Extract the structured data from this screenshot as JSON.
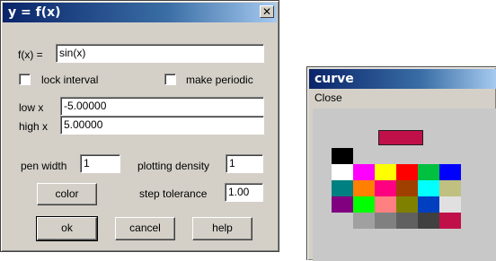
{
  "dialog": {
    "title": "y = f(x)",
    "close_glyph": "✕",
    "fx_label": "f(x) =",
    "fx_value": "sin(x)",
    "lock_interval_label": "lock interval",
    "make_periodic_label": "make periodic",
    "low_x_label": "low x",
    "low_x_value": "-5.00000",
    "high_x_label": "high x",
    "high_x_value": "5.00000",
    "pen_width_label": "pen width",
    "pen_width_value": "1",
    "plotting_density_label": "plotting density",
    "plotting_density_value": "1",
    "color_button": "color",
    "step_tolerance_label": "step tolerance",
    "step_tolerance_value": "1.00",
    "ok_button": "ok",
    "cancel_button": "cancel",
    "help_button": "help"
  },
  "curve_window": {
    "title": "curve",
    "menu_close": "Close",
    "selected_color": "#c0104a",
    "palette": [
      [
        "#000000",
        null,
        null,
        null,
        null,
        null
      ],
      [
        "#ffffff",
        "#ff00ff",
        "#ffff00",
        "#ff0000",
        "#00c040",
        "#0000ff"
      ],
      [
        "#008080",
        "#ff8000",
        "#ff0080",
        "#a04000",
        "#00ffff",
        "#c0c080"
      ],
      [
        "#800080",
        "#00ff00",
        "#ff8080",
        "#808000",
        "#0040c0",
        "#e0e0e0"
      ],
      [
        null,
        "#a0a0a0",
        "#808080",
        "#606060",
        "#404040",
        "#c0104a"
      ]
    ]
  }
}
